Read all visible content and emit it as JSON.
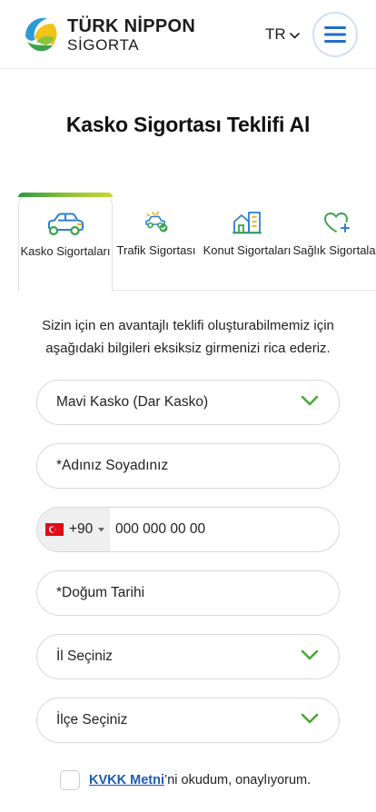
{
  "header": {
    "logo_line1": "TÜRK NİPPON",
    "logo_line2": "SİGORTA",
    "language": "TR"
  },
  "page_title": "Kasko Sigortası Teklifi Al",
  "tabs": [
    {
      "label": "Kasko Sigortaları",
      "icon": "car-icon",
      "active": true
    },
    {
      "label": "Trafik Sigortası",
      "icon": "car-crash-icon",
      "active": false
    },
    {
      "label": "Konut Sigortaları",
      "icon": "buildings-icon",
      "active": false
    },
    {
      "label": "Sağlık Sigortaları",
      "icon": "heart-plus-icon",
      "active": false
    }
  ],
  "intro_text": "Sizin için en avantajlı teklifi oluşturabilmemiz için aşağıdaki bilgileri eksiksiz girmenizi rica ederiz.",
  "form": {
    "product_select": "Mavi Kasko (Dar Kasko)",
    "name_placeholder": "*Adınız Soyadınız",
    "phone_code": "+90",
    "phone_placeholder": "000 000 00 00",
    "birthdate_placeholder": "*Doğum Tarihi",
    "province_select": "İl Seçiniz",
    "district_select": "İlçe Seçiniz"
  },
  "kvkk": {
    "link_text": "KVKK Metni",
    "text": "’ni okudum, onaylıyorum."
  },
  "colors": {
    "accent_green": "#4aa53c",
    "brand_blue": "#1f6fc7",
    "gradient": [
      "#2d9a45",
      "#93c33a",
      "#c9d72f"
    ]
  }
}
